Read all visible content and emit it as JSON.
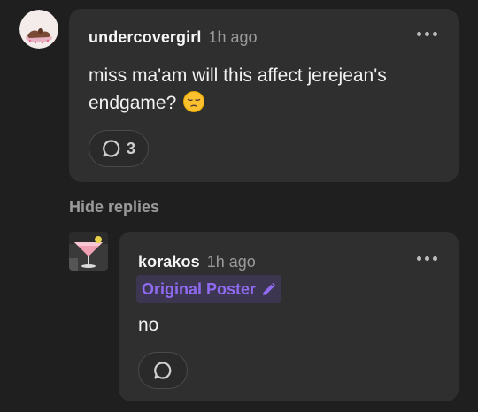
{
  "comment": {
    "username": "undercovergirl",
    "time": "1h ago",
    "text": "miss ma'am will this affect jerejean's endgame?",
    "emoji": "pensive-face-emoji",
    "reply_count": "3"
  },
  "hide_replies_label": "Hide replies",
  "reply": {
    "username": "korakos",
    "time": "1h ago",
    "badge_label": "Original Poster",
    "text": "no"
  },
  "colors": {
    "background": "#1f1f1f",
    "card": "#2f2f2f",
    "badge_bg": "#3d3650",
    "badge_text": "#8f6bf2",
    "muted": "#9a9a9a"
  }
}
